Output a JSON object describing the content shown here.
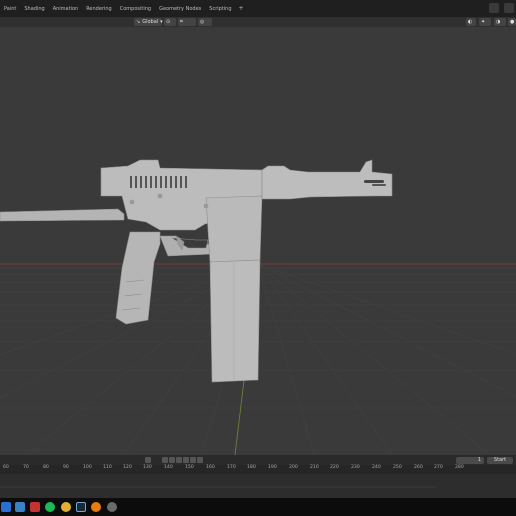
{
  "workspace_tabs": [
    "Paint",
    "Shading",
    "Animation",
    "Rendering",
    "Compositing",
    "Geometry Nodes",
    "Scripting",
    "+"
  ],
  "viewport_header": {
    "transform_orientation": "Global"
  },
  "timeline": {
    "current_frame": "1",
    "start_label": "Start",
    "ruler_ticks": [
      "60",
      "70",
      "80",
      "90",
      "100",
      "110",
      "120",
      "130",
      "140",
      "150",
      "160",
      "170",
      "180",
      "190",
      "200",
      "210",
      "220",
      "230",
      "240",
      "250",
      "260",
      "270",
      "280"
    ]
  },
  "colors": {
    "viewport_bg": "#3a3a3a",
    "model_grey": "#b8b8b8",
    "x_axis": "#8a3d3d",
    "y_axis": "#6f8a3a",
    "taskbar_bg": "#0c0c0c"
  },
  "taskbar_icons": [
    "windows-start-icon",
    "file-explorer-icon",
    "red-app-icon",
    "spotify-icon",
    "chrome-icon",
    "steam-icon",
    "blender-icon",
    "settings-icon"
  ]
}
